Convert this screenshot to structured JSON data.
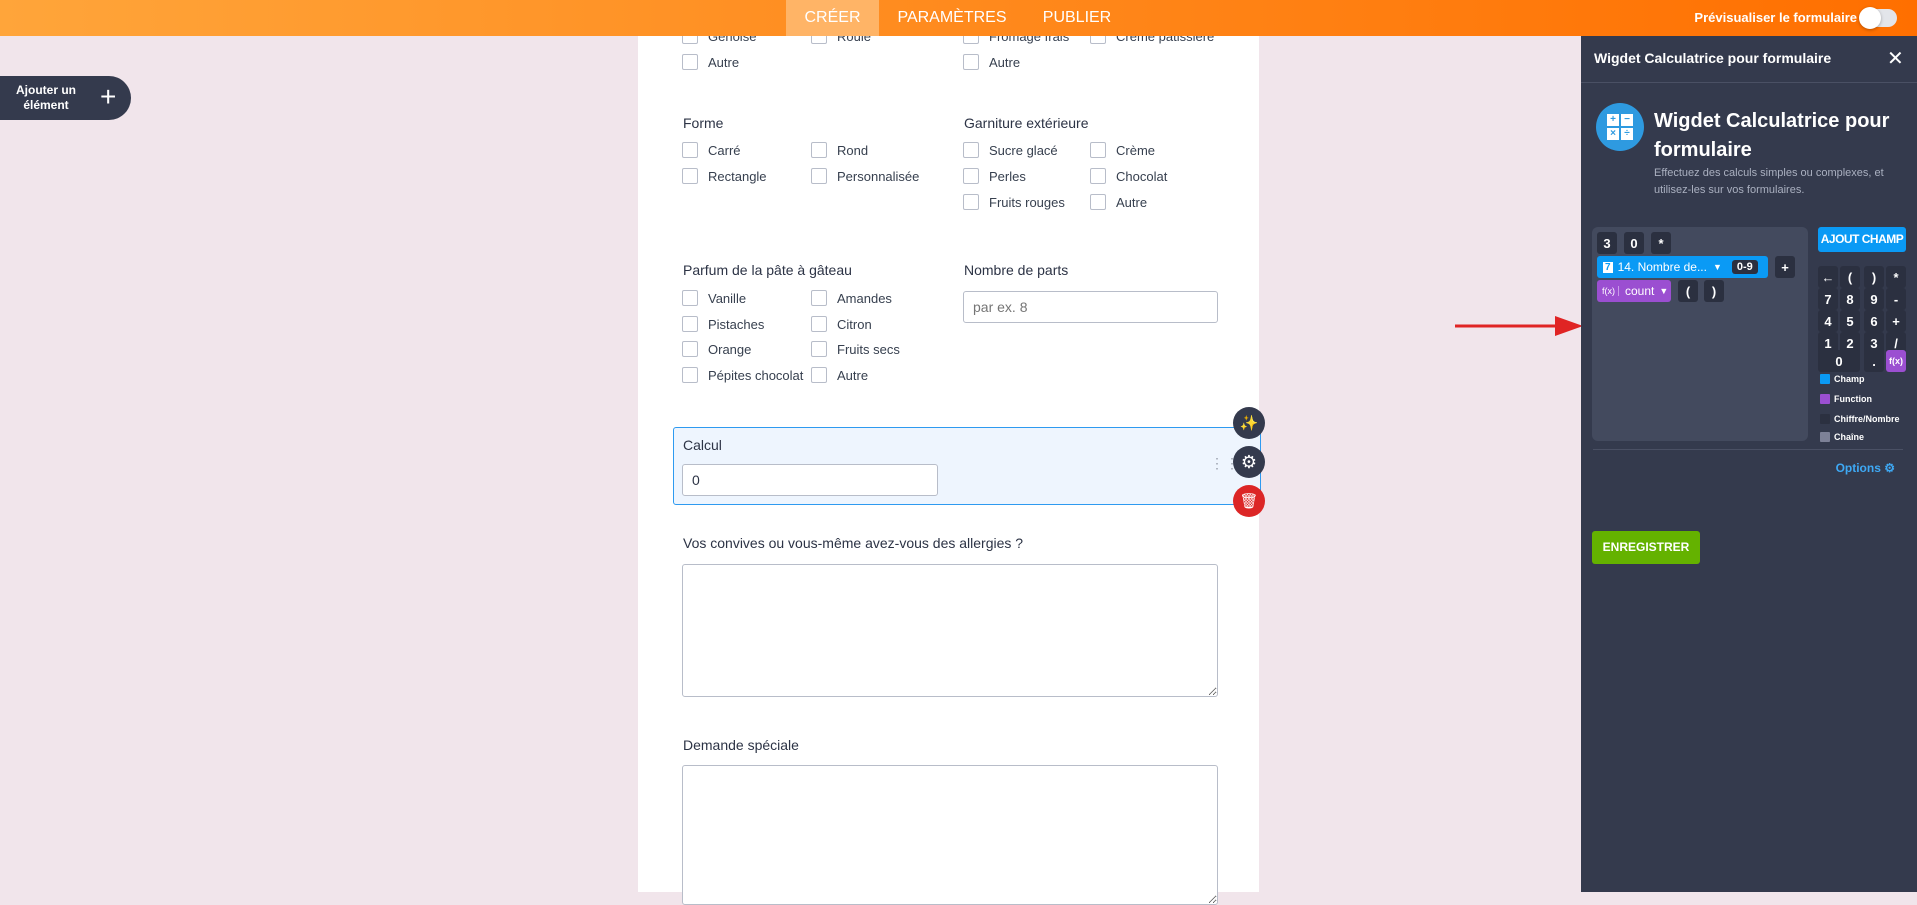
{
  "topbar": {
    "tabs": [
      "CRÉER",
      "PARAMÈTRES",
      "PUBLIER"
    ],
    "active_tab": "CRÉER",
    "preview_label": "Prévisualiser le formulaire",
    "preview_on": false
  },
  "add_element": {
    "label": "Ajouter un élément"
  },
  "form": {
    "top_group_left": [
      "Génoise",
      "Roulé",
      "Autre"
    ],
    "top_group_right": [
      "Fromage frais",
      "Crème pâtissière",
      "Autre"
    ],
    "forme": {
      "label": "Forme",
      "options": [
        "Carré",
        "Rond",
        "Rectangle",
        "Personnalisée"
      ]
    },
    "garniture": {
      "label": "Garniture extérieure",
      "options": [
        "Sucre glacé",
        "Crème",
        "Perles",
        "Chocolat",
        "Fruits rouges",
        "Autre"
      ]
    },
    "parfum": {
      "label": "Parfum de la pâte à gâteau",
      "options": [
        "Vanille",
        "Amandes",
        "Pistaches",
        "Citron",
        "Orange",
        "Fruits secs",
        "Pépites chocolat",
        "Autre"
      ]
    },
    "parts": {
      "label": "Nombre de parts",
      "placeholder": "par ex. 8"
    },
    "calcul": {
      "label": "Calcul",
      "value": "0"
    },
    "allergies": {
      "label": "Vos convives ou vous-même avez-vous des allergies ?"
    },
    "demande": {
      "label": "Demande spéciale"
    }
  },
  "panel": {
    "header_title": "Wigdet Calculatrice pour formulaire",
    "title": "Wigdet Calculatrice pour formulaire",
    "description": "Effectuez des calculs simples ou complexes, et utilisez-les sur vos formulaires.",
    "formula": {
      "row1": [
        "3",
        "0",
        "*"
      ],
      "field_chip": {
        "num": "7",
        "label": "14. Nombre de...",
        "range": "0-9"
      },
      "plus": "+",
      "function_chip": {
        "icon": "f(x)",
        "label": "count"
      },
      "parens": [
        "(",
        ")"
      ]
    },
    "add_field": "AJOUT CHAMP",
    "keypad": [
      [
        "←",
        "(",
        ")",
        "*"
      ],
      [
        "7",
        "8",
        "9",
        "-"
      ],
      [
        "4",
        "5",
        "6",
        "+"
      ],
      [
        "1",
        "2",
        "3",
        "/"
      ]
    ],
    "keypad_last": [
      "0",
      ".",
      "f(x)"
    ],
    "legend": [
      {
        "label": "Champ",
        "color": "#0a9af5"
      },
      {
        "label": "Function",
        "color": "#9b4fd1"
      },
      {
        "label": "Chiffre/Nombre",
        "color": "#2b3040"
      },
      {
        "label": "Chaîne",
        "color": "#7d8197"
      }
    ],
    "options_label": "Options",
    "save_label": "ENREGISTRER"
  },
  "colors": {
    "accent": "#ff7a0f",
    "panel": "#343a4d",
    "field": "#0a9af5",
    "function": "#9b4fd1",
    "save": "#64b200",
    "delete": "#dc2626"
  }
}
